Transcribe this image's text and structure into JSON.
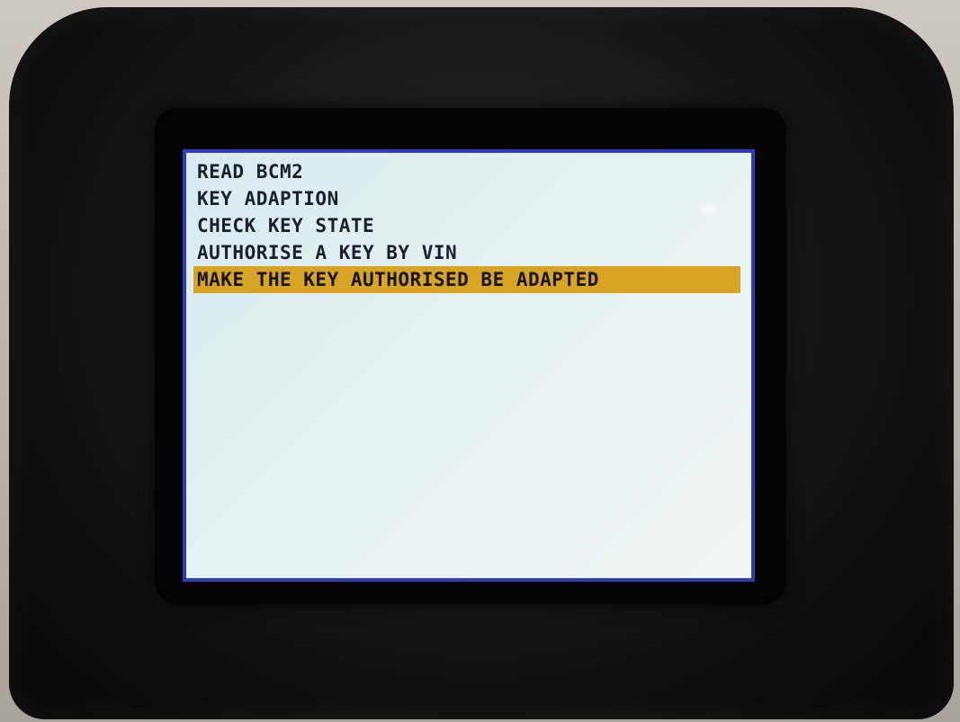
{
  "menu": {
    "items": [
      {
        "label": "READ BCM2",
        "selected": false
      },
      {
        "label": "KEY ADAPTION",
        "selected": false
      },
      {
        "label": "CHECK KEY STATE",
        "selected": false
      },
      {
        "label": "AUTHORISE A KEY BY VIN",
        "selected": false
      },
      {
        "label": "MAKE THE KEY AUTHORISED BE ADAPTED",
        "selected": true
      }
    ]
  },
  "colors": {
    "screen_border": "#2f3bb8",
    "screen_background": "#e6f2f2",
    "selection_highlight": "#d9a324",
    "text": "#1a1f2e",
    "device_body": "#131314"
  }
}
